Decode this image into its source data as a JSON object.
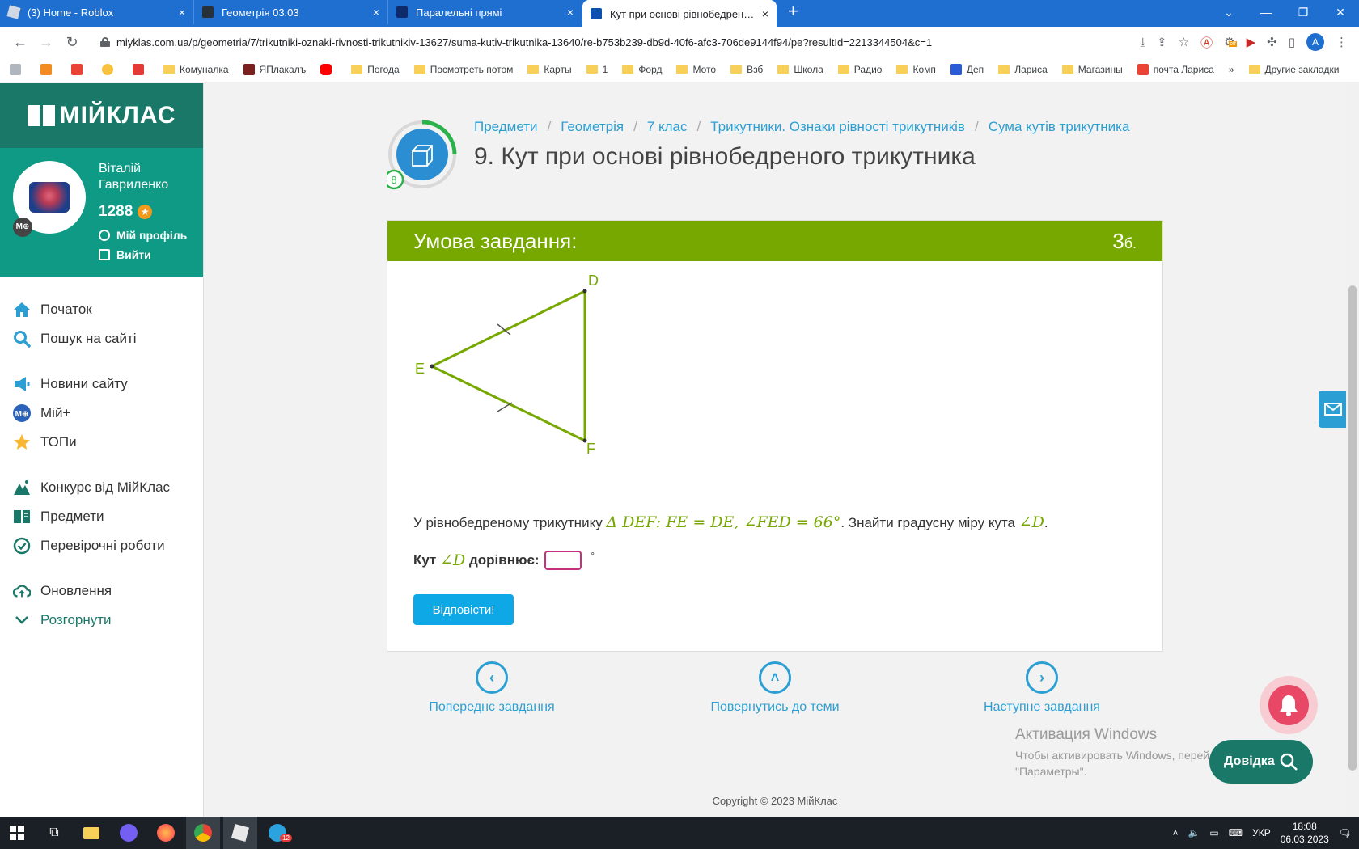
{
  "browser": {
    "tabs": [
      {
        "title": "(3) Home - Roblox",
        "close": "×"
      },
      {
        "title": "Геометрія 03.03",
        "close": "×"
      },
      {
        "title": "Паралельні прямі",
        "close": "×"
      },
      {
        "title": "Кут при основі рівнобедреного",
        "close": "×"
      }
    ],
    "new_tab": "+",
    "url": "miyklas.com.ua/p/geometria/7/trikutniki-oznaki-rivnosti-trikutnikiv-13627/suma-kutiv-trikutnika-13640/re-b753b239-db9d-40f6-afc3-706de9144f94/pe?resultId=2213344504&c=1",
    "profile_letter": "A",
    "ext_badge": "off",
    "bookmarks": [
      "Комуналка",
      "ЯПлакалъ",
      "Погода",
      "Посмотреть потом",
      "Карты",
      "1",
      "Форд",
      "Мото",
      "Взб",
      "Школа",
      "Радио",
      "Комп",
      "Деп",
      "Лариса",
      "Магазины",
      "почта Лариса"
    ],
    "bookmarks_more": "»",
    "other_bookmarks": "Другие закладки"
  },
  "sidebar": {
    "logo": "МІЙКЛАС",
    "user": {
      "first": "Віталій",
      "last": "Гавриленко",
      "points": "1288",
      "badge": "M⊕",
      "profile": "Мій профіль",
      "logout": "Вийти"
    },
    "menu": [
      {
        "label": "Початок",
        "icon": "home-icon"
      },
      {
        "label": "Пошук на сайті",
        "icon": "search-icon"
      },
      {
        "label": "Новини сайту",
        "icon": "news-icon"
      },
      {
        "label": "Мій+",
        "icon": "myplus-icon"
      },
      {
        "label": "ТОПи",
        "icon": "star-icon"
      },
      {
        "label": "Конкурс від МійКлас",
        "icon": "contest-icon"
      },
      {
        "label": "Предмети",
        "icon": "book-icon"
      },
      {
        "label": "Перевірочні роботи",
        "icon": "check-icon"
      },
      {
        "label": "Оновлення",
        "icon": "cloud-icon"
      },
      {
        "label": "Розгорнути",
        "icon": "chevron-down-icon"
      }
    ]
  },
  "breadcrumbs": [
    "Предмети",
    "Геометрія",
    "7 клас",
    "Трикутники. Ознаки рівності трикутників",
    "Сума кутів трикутника"
  ],
  "progress_badge": "8",
  "page_title": "9. Кут при основі рівнобедреного трикутника",
  "task": {
    "header": "Умова завдання:",
    "points_num": "3",
    "points_unit": "б.",
    "figure": {
      "labels": {
        "D": "D",
        "E": "E",
        "F": "F"
      }
    },
    "statement_prefix": "У рівнобедреному трикутнику ",
    "statement_math": "Δ DEF: FE = DE,  ∠FED = 66°",
    "statement_mid": ". Знайти градусну міру кута ",
    "statement_math2": "∠D",
    "statement_end": ".",
    "answer_prefix": "Кут ",
    "answer_math": "∠D",
    "answer_suffix": " дорівнює:",
    "answer_value": "",
    "degree": "°",
    "submit": "Відповісти!"
  },
  "nav": {
    "prev": "Попереднє завдання",
    "up": "Повернутись до теми",
    "next": "Наступне завдання"
  },
  "windows_watermark": {
    "line1": "Активация Windows",
    "line2": "Чтобы активировать Windows, перейдите в раздел",
    "line3": "\"Параметры\"."
  },
  "help_button": "Довідка",
  "copyright": "Copyright © 2023 МійКлас",
  "taskbar": {
    "lang": "УКР",
    "time": "18:08",
    "date": "06.03.2023",
    "telegram_badge": "12",
    "notif_badge": "2"
  },
  "colors": {
    "brand_dark": "#197868",
    "brand": "#0f9a85",
    "task_header": "#76a800",
    "link": "#2b9fd3",
    "submit": "#0ea8e6",
    "tab_bar": "#1f6fd1"
  }
}
